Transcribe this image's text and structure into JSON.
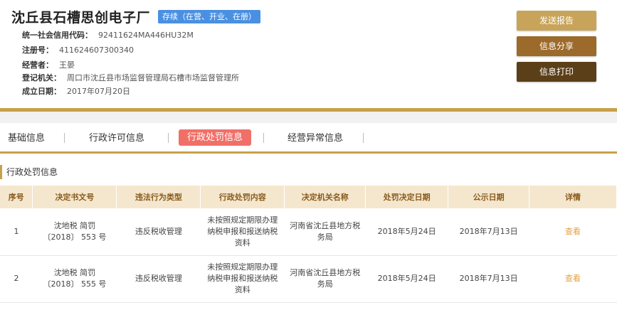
{
  "company": {
    "name": "沈丘县石槽思创电子厂",
    "status": "存续（在营、开业、在册）"
  },
  "info": [
    {
      "label": "统一社会信用代码：",
      "value": "92411624MA446HU32M"
    },
    {
      "label": "注册号：",
      "value": "411624607300340"
    },
    {
      "label": "经营者：",
      "value": "王晏"
    },
    {
      "label": "登记机关：",
      "value": "周口市沈丘县市场监督管理局石槽市场监督管理所"
    },
    {
      "label": "成立日期：",
      "value": "2017年07月20日"
    }
  ],
  "actions": {
    "report": "发送报告",
    "share": "信息分享",
    "print": "信息打印"
  },
  "tabs": [
    "基础信息",
    "行政许可信息",
    "行政处罚信息",
    "经营异常信息"
  ],
  "active_tab": "行政处罚信息",
  "section_title": "行政处罚信息",
  "table": {
    "headers": [
      "序号",
      "决定书文号",
      "违法行为类型",
      "行政处罚内容",
      "决定机关名称",
      "处罚决定日期",
      "公示日期",
      "详情"
    ],
    "rows": [
      {
        "no": "1",
        "doc_no": "沈地税 简罚 〔2018〕 553 号",
        "type": "违反税收管理",
        "content": "未按照规定期限办理纳税申报和报送纳税资料",
        "authority": "河南省沈丘县地方税务局",
        "decision_date": "2018年5月24日",
        "publish_date": "2018年7月13日",
        "detail": "查看"
      },
      {
        "no": "2",
        "doc_no": "沈地税 简罚 〔2018〕 555 号",
        "type": "违反税收管理",
        "content": "未按照规定期限办理纳税申报和报送纳税资料",
        "authority": "河南省沈丘县地方税务局",
        "decision_date": "2018年5月24日",
        "publish_date": "2018年7月13日",
        "detail": "查看"
      }
    ]
  }
}
